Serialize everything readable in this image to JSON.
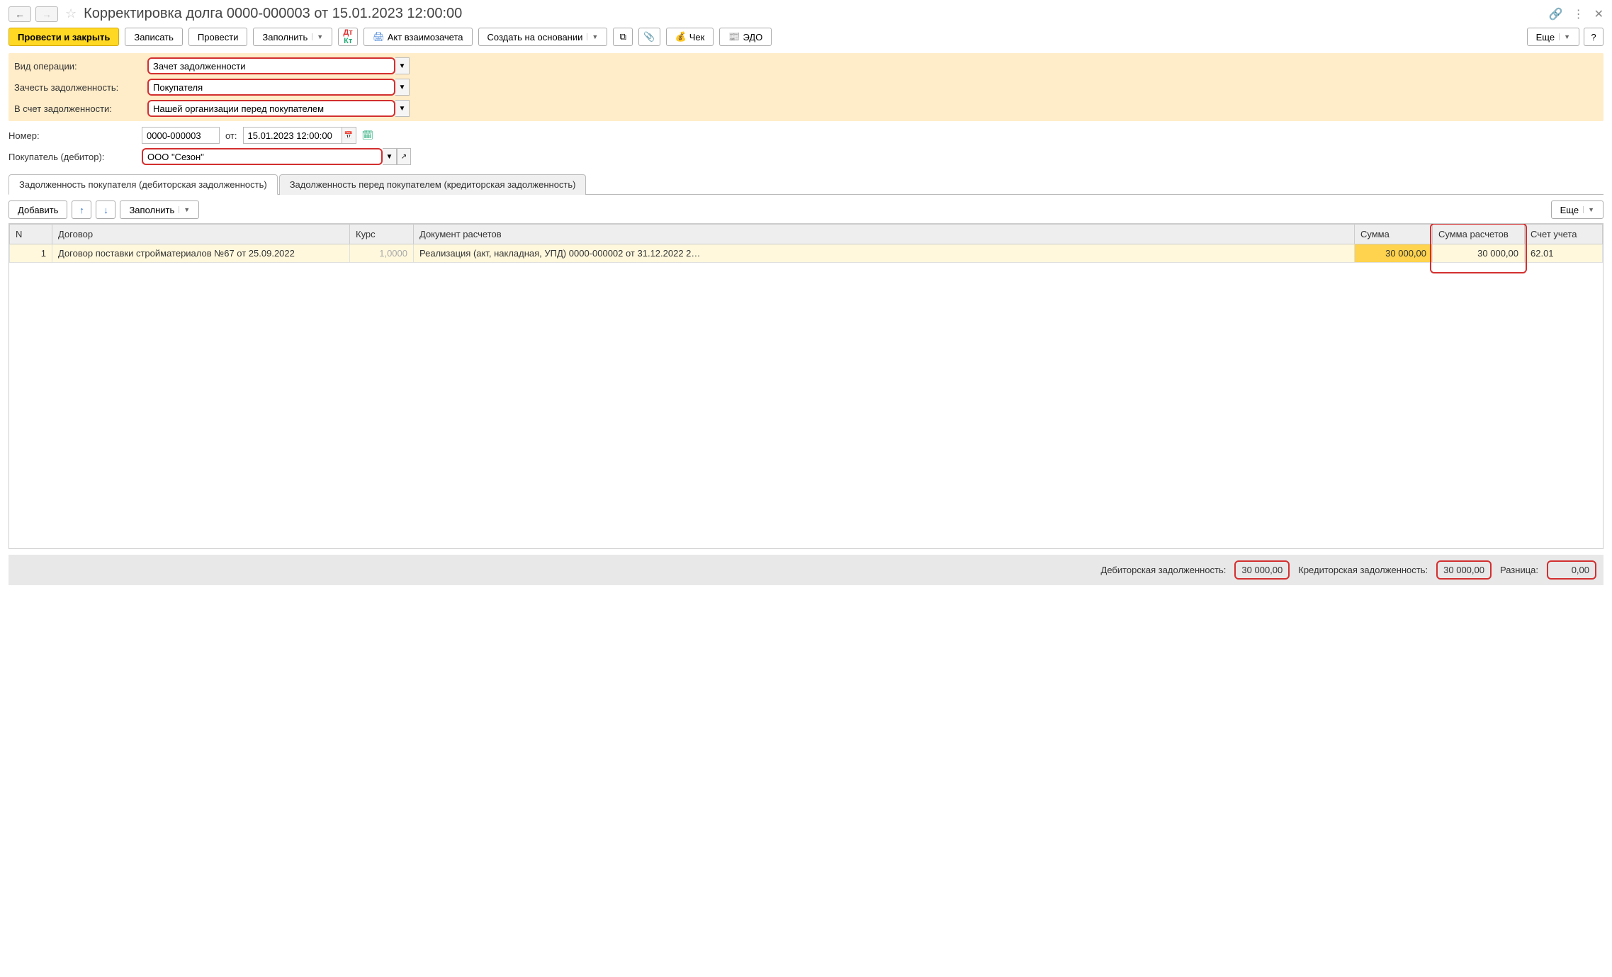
{
  "header": {
    "title": "Корректировка долга 0000-000003 от 15.01.2023 12:00:00"
  },
  "toolbar": {
    "post_close": "Провести и закрыть",
    "save": "Записать",
    "post": "Провести",
    "fill": "Заполнить",
    "act": "Акт взаимозачета",
    "create_based": "Создать на основании",
    "receipt": "Чек",
    "edo": "ЭДО",
    "more": "Еще",
    "help": "?"
  },
  "form": {
    "op_type_label": "Вид операции:",
    "op_type_value": "Зачет задолженности",
    "offset_label": "Зачесть задолженность:",
    "offset_value": "Покупателя",
    "against_label": "В счет задолженности:",
    "against_value": "Нашей организации перед покупателем",
    "number_label": "Номер:",
    "number_value": "0000-000003",
    "date_label": "от:",
    "date_value": "15.01.2023 12:00:00",
    "buyer_label": "Покупатель (дебитор):",
    "buyer_value": "ООО \"Сезон\""
  },
  "tabs": {
    "tab1": "Задолженность покупателя (дебиторская задолженность)",
    "tab2": "Задолженность перед покупателем (кредиторская задолженность)"
  },
  "table_toolbar": {
    "add": "Добавить",
    "fill": "Заполнить",
    "more": "Еще"
  },
  "columns": {
    "n": "N",
    "contract": "Договор",
    "rate": "Курс",
    "doc": "Документ расчетов",
    "sum": "Сумма",
    "sum_calc": "Сумма расчетов",
    "account": "Счет учета"
  },
  "rows": [
    {
      "n": "1",
      "contract": "Договор поставки стройматериалов №67 от 25.09.2022",
      "rate": "1,0000",
      "doc": "Реализация (акт, накладная, УПД) 0000-000002 от 31.12.2022 2…",
      "sum": "30 000,00",
      "sum_calc": "30 000,00",
      "account": "62.01"
    }
  ],
  "footer": {
    "debit_label": "Дебиторская задолженность:",
    "debit_value": "30 000,00",
    "credit_label": "Кредиторская задолженность:",
    "credit_value": "30 000,00",
    "diff_label": "Разница:",
    "diff_value": "0,00"
  }
}
